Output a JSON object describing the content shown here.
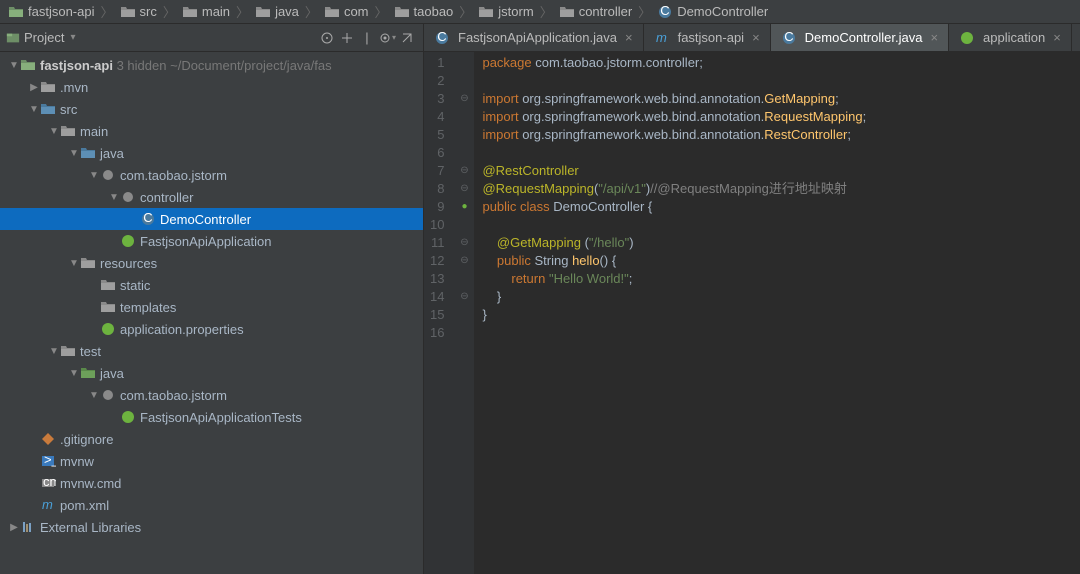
{
  "breadcrumb": [
    "fastjson-api",
    "src",
    "main",
    "java",
    "com",
    "taobao",
    "jstorm",
    "controller",
    "DemoController"
  ],
  "project_panel": {
    "title": "Project"
  },
  "tree": {
    "root_name": "fastjson-api",
    "root_hidden": "3 hidden",
    "root_path": "~/Document/project/java/fas",
    "mvn": ".mvn",
    "src": "src",
    "main": "main",
    "java": "java",
    "pkg": "com.taobao.jstorm",
    "controller": "controller",
    "democtrl": "DemoController",
    "fastapp": "FastjsonApiApplication",
    "resources": "resources",
    "static": "static",
    "templates": "templates",
    "appprops": "application.properties",
    "test": "test",
    "testjava": "java",
    "testpkg": "com.taobao.jstorm",
    "testclass": "FastjsonApiApplicationTests",
    "gitignore": ".gitignore",
    "mvnw": "mvnw",
    "mvnwcmd": "mvnw.cmd",
    "pom": "pom.xml",
    "extlibs": "External Libraries"
  },
  "tabs": [
    {
      "label": "FastjsonApiApplication.java",
      "icon": "class"
    },
    {
      "label": "fastjson-api",
      "icon": "maven"
    },
    {
      "label": "DemoController.java",
      "icon": "class",
      "active": true
    },
    {
      "label": "application",
      "icon": "spring"
    }
  ],
  "code": {
    "l1": {
      "kw": "package",
      "rest": " com.taobao.jstorm.controller;"
    },
    "l3": {
      "kw": "import",
      "rest": " org.springframework.web.bind.annotation.",
      "cls": "GetMapping",
      "end": ";"
    },
    "l4": {
      "kw": "import",
      "rest": " org.springframework.web.bind.annotation.",
      "cls": "RequestMapping",
      "end": ";"
    },
    "l5": {
      "kw": "import",
      "rest": " org.springframework.web.bind.annotation.",
      "cls": "RestController",
      "end": ";"
    },
    "l7": {
      "ann": "@RestController"
    },
    "l8": {
      "ann": "@RequestMapping",
      "paren": "(",
      "str": "\"/api/v1\"",
      "paren2": ")",
      "com": "//@RequestMapping进行地址映射"
    },
    "l9": {
      "kw": "public class",
      "cls": " DemoController ",
      "brace": "{"
    },
    "l11": {
      "ann": "@GetMapping ",
      "paren": "(",
      "str": "\"/hello\"",
      "paren2": ")"
    },
    "l12": {
      "kw": "public",
      "typ": " String ",
      "method": "hello",
      "rest": "() {"
    },
    "l13": {
      "kw": "return ",
      "str": "\"Hello World!\"",
      "end": ";"
    },
    "l14": "}",
    "l15": "}"
  },
  "line_count": 16
}
